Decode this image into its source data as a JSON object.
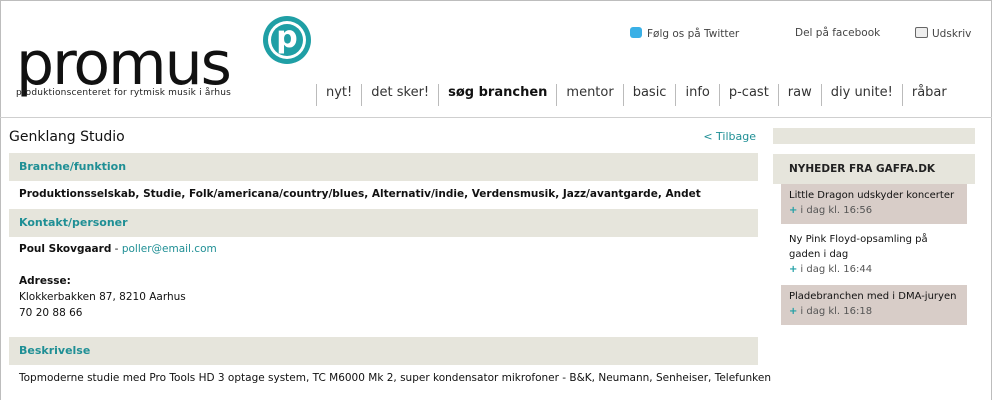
{
  "logo": {
    "word": "promus",
    "badge_letter": "p",
    "tagline": "produktionscenteret for rytmisk musik i århus"
  },
  "toplinks": {
    "twitter": "Følg os på Twitter",
    "facebook": "Del på facebook",
    "print": "Udskriv"
  },
  "nav": {
    "items": [
      "nyt!",
      "det sker!",
      "søg branchen",
      "mentor",
      "basic",
      "info",
      "p-cast",
      "raw",
      "diy unite!",
      "råbar"
    ],
    "active": "søg branchen"
  },
  "page": {
    "title": "Genklang Studio",
    "back": "< Tilbage"
  },
  "sections": {
    "branche": {
      "title": "Branche/funktion",
      "text": "Produktionsselskab, Studie, Folk/americana/country/blues, Alternativ/indie, Verdensmusik, Jazz/avantgarde, Andet"
    },
    "kontakt": {
      "title": "Kontakt/personer",
      "person": "Poul Skovgaard",
      "separator": " - ",
      "email": "poller@email.com",
      "address_label": "Adresse:",
      "address": "Klokkerbakken 87, 8210 Aarhus",
      "phone": "70 20 88 66"
    },
    "beskrivelse": {
      "title": "Beskrivelse",
      "text": "Topmoderne studie med Pro Tools HD 3 optage system, TC M6000 Mk 2, super kondensator mikrofoner - B&K, Neumann, Senheiser, Telefunken"
    }
  },
  "sidebar": {
    "heading": "NYHEDER FRA GAFFA.DK",
    "news": [
      {
        "title": "Little Dragon udskyder koncerter",
        "plus": "+",
        "meta": "i dag kl. 16:56"
      },
      {
        "title": "Ny Pink Floyd-opsamling på gaden i dag",
        "plus": "+",
        "meta": "i dag kl. 16:44"
      },
      {
        "title": "Pladebranchen med i DMA-juryen",
        "plus": "+",
        "meta": "i dag kl. 16:18"
      }
    ]
  }
}
